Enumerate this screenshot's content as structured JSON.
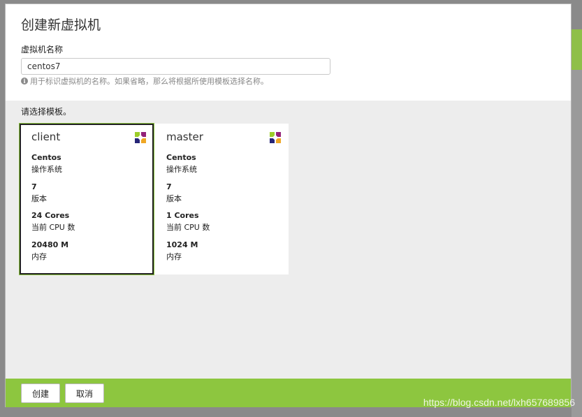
{
  "modal": {
    "title": "创建新虚拟机",
    "name_label": "虚拟机名称",
    "name_value": "centos7",
    "help_text": "用于标识虚拟机的名称。如果省略，那么将根据所使用模板选择名称。",
    "template_label": "请选择模板。"
  },
  "templates": [
    {
      "name": "client",
      "os_value": "Centos",
      "os_label": "操作系统",
      "version_value": "7",
      "version_label": "版本",
      "cpu_value": "24 Cores",
      "cpu_label": "当前 CPU 数",
      "mem_value": "20480 M",
      "mem_label": "内存",
      "selected": true
    },
    {
      "name": "master",
      "os_value": "Centos",
      "os_label": "操作系统",
      "version_value": "7",
      "version_label": "版本",
      "cpu_value": "1 Cores",
      "cpu_label": "当前 CPU 数",
      "mem_value": "1024 M",
      "mem_label": "内存",
      "selected": false
    }
  ],
  "footer": {
    "create_label": "创建",
    "cancel_label": "取消"
  },
  "watermark": "https://blog.csdn.net/lxh657689856",
  "colors": {
    "accent": "#8dc63f",
    "modal_bg": "#ededed"
  },
  "icons": {
    "os": "centos-logo-icon",
    "info": "info-icon"
  }
}
